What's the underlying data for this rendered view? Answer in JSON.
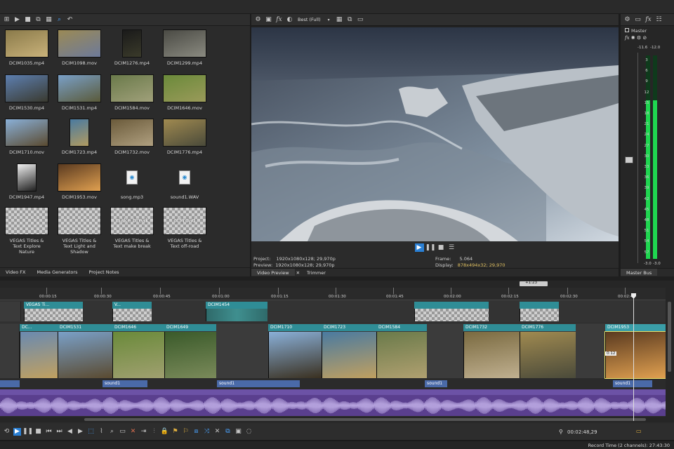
{
  "media_bin": {
    "items": [
      {
        "label": "DCIM1035.mp4",
        "c1": "#8a7a4a",
        "c2": "#c9b27a",
        "icon": "video-thumbnail"
      },
      {
        "label": "DCIM1098.mov",
        "c1": "#9b8a55",
        "c2": "#6d7a9a",
        "icon": "video-thumbnail"
      },
      {
        "label": "DCIM1276.mp4",
        "c1": "#1a1a1a",
        "c2": "#3a3a2a",
        "icon": "video-thumbnail"
      },
      {
        "label": "DCIM1299.mp4",
        "c1": "#4a4a44",
        "c2": "#8a8a80",
        "icon": "video-thumbnail"
      },
      {
        "label": "DCIM1530.mp4",
        "c1": "#5d7fb0",
        "c2": "#3a3a30",
        "icon": "video-thumbnail"
      },
      {
        "label": "DCIM1531.mp4",
        "c1": "#7aa0c8",
        "c2": "#5a5a3a",
        "icon": "video-thumbnail"
      },
      {
        "label": "DCIM1584.mov",
        "c1": "#6a7a4a",
        "c2": "#a0a07a",
        "icon": "video-thumbnail"
      },
      {
        "label": "DCIM1646.mov",
        "c1": "#6a8a3a",
        "c2": "#9a9a5a",
        "icon": "video-thumbnail"
      },
      {
        "label": "DCIM1710.mov",
        "c1": "#8ab0d8",
        "c2": "#5a4a30",
        "icon": "video-thumbnail"
      },
      {
        "label": "DCIM1723.mp4",
        "c1": "#4a7aa0",
        "c2": "#b09a60",
        "icon": "video-thumbnail"
      },
      {
        "label": "DCIM1732.mov",
        "c1": "#6a5a3a",
        "c2": "#b0a080",
        "icon": "video-thumbnail"
      },
      {
        "label": "DCIM1776.mp4",
        "c1": "#a08a50",
        "c2": "#4a4a3a",
        "icon": "video-thumbnail"
      },
      {
        "label": "DCIM1947.mp4",
        "c1": "#f0f0f0",
        "c2": "#202020",
        "icon": "video-thumbnail"
      },
      {
        "label": "DCIM1953.mov",
        "c1": "#5a3a20",
        "c2": "#e0a050",
        "icon": "video-thumbnail"
      },
      {
        "label": "song.mp3",
        "c1": "#ffffff",
        "c2": "#ffffff",
        "icon": "audio-file-icon"
      },
      {
        "label": "sound1.WAV",
        "c1": "#ffffff",
        "c2": "#ffffff",
        "icon": "audio-file-icon"
      },
      {
        "label": "VEGAS Titles & Text Explore Nature",
        "overlay": "",
        "icon": "title-thumbnail"
      },
      {
        "label": "VEGAS Titles & Text Light and Shadow",
        "overlay": "",
        "icon": "title-thumbnail"
      },
      {
        "label": "VEGAS Titles & Text make break",
        "overlay": "make break",
        "icon": "title-thumbnail"
      },
      {
        "label": "VEGAS Titles & Text off-road",
        "overlay": "off-road",
        "icon": "title-thumbnail"
      }
    ]
  },
  "bottom_tabs": [
    "Video FX",
    "Media Generators",
    "Project Notes"
  ],
  "preview": {
    "quality": "Best (Full)",
    "project_label": "Project:",
    "project_value": "1920x1080x128; 29,970p",
    "preview_label": "Preview:",
    "preview_value": "1920x1080x128; 29,970p",
    "frame_label": "Frame:",
    "frame_value": "5.064",
    "display_label": "Display:",
    "display_value": "878x494x32; 29,970",
    "tabs": [
      "Video Preview",
      "Trimmer"
    ]
  },
  "master": {
    "title": "Master",
    "peak_left": "-11.6",
    "peak_right": "-12.0",
    "scale": [
      "3",
      "6",
      "9",
      "12",
      "15",
      "18",
      "21",
      "24",
      "27",
      "30",
      "33",
      "36",
      "39",
      "42",
      "45",
      "48",
      "51",
      "54",
      "57"
    ],
    "bottom_left": "-3.0",
    "bottom_right": "-3.0",
    "tab": "Master Bus",
    "level_left": 0.78,
    "level_right": 0.78
  },
  "timeline": {
    "ruler": [
      "00:00:15",
      "00:00:30",
      "00:00:45",
      "00:01:00",
      "00:01:15",
      "00:01:30",
      "00:01:45",
      "00:02:00",
      "00:02:15",
      "00:02:30",
      "00:02:45"
    ],
    "ruler_marker": "+1:23",
    "title_clips": [
      "VEGAS Ti...",
      "V...",
      "DCIM1454"
    ],
    "video_clips": [
      "DC...",
      "DCIM1531",
      "DCIM1646",
      "DCIM1649",
      "DCIM1710",
      "DCIM1723",
      "DCIM1584",
      "DCIM1732",
      "DCIM1776",
      "DCIM1953"
    ],
    "audio_clips": [
      "sound1",
      "sound1",
      "sound1",
      "sound1"
    ],
    "clip_marker": "0:12"
  },
  "transport": {
    "time": "00:02:48,29",
    "record_time": "Record Time (2 channels): 27:43:30"
  },
  "colors": {
    "clip_header": "#2f8d96",
    "audio_track": "#5a3f8e",
    "meter_green": "#1fd650",
    "accent_blue": "#4aa3ff"
  }
}
